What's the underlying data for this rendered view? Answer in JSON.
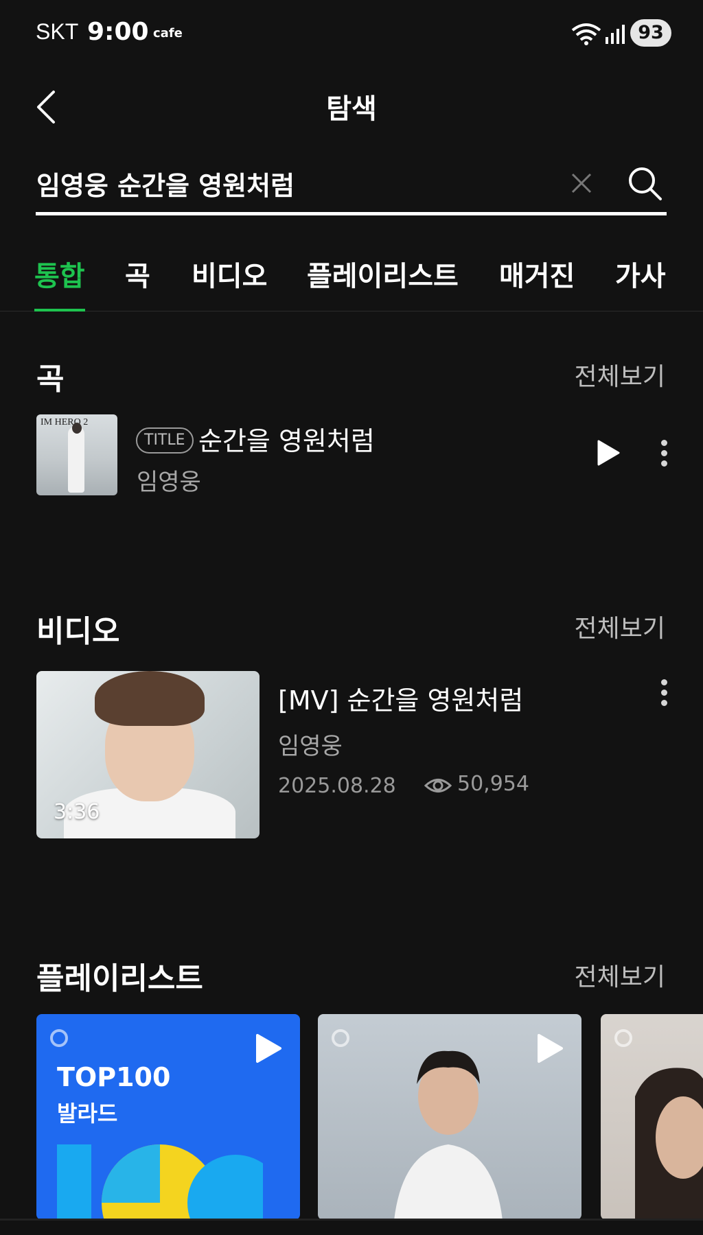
{
  "status_bar": {
    "carrier": "SKT",
    "time": "9:00",
    "app": "cafe",
    "battery": "93"
  },
  "header": {
    "title": "탐색",
    "back_icon": "chevron-left-icon"
  },
  "search": {
    "query": "임영웅 순간을 영원처럼"
  },
  "tabs": [
    {
      "label": "통합",
      "active": true
    },
    {
      "label": "곡"
    },
    {
      "label": "비디오"
    },
    {
      "label": "플레이리스트"
    },
    {
      "label": "매거진"
    },
    {
      "label": "가사"
    }
  ],
  "songs_section": {
    "title": "곡",
    "see_all": "전체보기",
    "items": [
      {
        "badge": "TITLE",
        "name": "순간을 영원처럼",
        "artist": "임영웅",
        "cover_text": "IM HERO 2"
      }
    ]
  },
  "video_section": {
    "title": "비디오",
    "see_all": "전체보기",
    "items": [
      {
        "title": "[MV] 순간을 영원처럼",
        "artist": "임영웅",
        "date": "2025.08.28",
        "views": "50,954",
        "duration": "3:36"
      }
    ]
  },
  "playlist_section": {
    "title": "플레이리스트",
    "see_all": "전체보기",
    "items": [
      {
        "line1": "TOP100",
        "line2": "발라드"
      },
      {},
      {}
    ]
  },
  "colors": {
    "accent": "#1ec34f",
    "background": "#121212"
  }
}
